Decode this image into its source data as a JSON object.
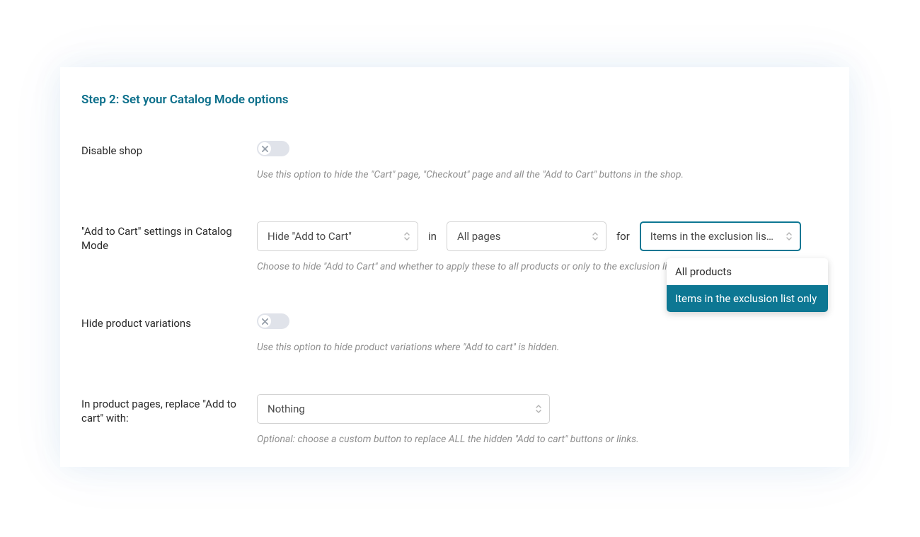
{
  "step_title": "Step 2: Set your Catalog Mode options",
  "rows": {
    "disable_shop": {
      "label": "Disable shop",
      "help": "Use this option to hide the \"Cart\" page, \"Checkout\" page and all the \"Add to Cart\" buttons in the shop."
    },
    "atc_settings": {
      "label": "\"Add to Cart\" settings in Catalog Mode",
      "select1": "Hide \"Add to Cart\"",
      "word_in": "in",
      "select2": "All pages",
      "word_for": "for",
      "select3": "Items in the exclusion list o...",
      "help": "Choose to hide \"Add to Cart\" and whether to apply these to all products or only to the exclusion list.",
      "dropdown": {
        "opt0": "All products",
        "opt1": "Items in the exclusion list only"
      }
    },
    "hide_variations": {
      "label": "Hide product variations",
      "help": "Use this option to hide product variations where \"Add to cart\" is hidden."
    },
    "replace_atc": {
      "label": "In product pages, replace \"Add to cart\" with:",
      "select": "Nothing",
      "help": "Optional: choose a custom button to replace ALL the hidden \"Add to cart\" buttons or links."
    }
  }
}
